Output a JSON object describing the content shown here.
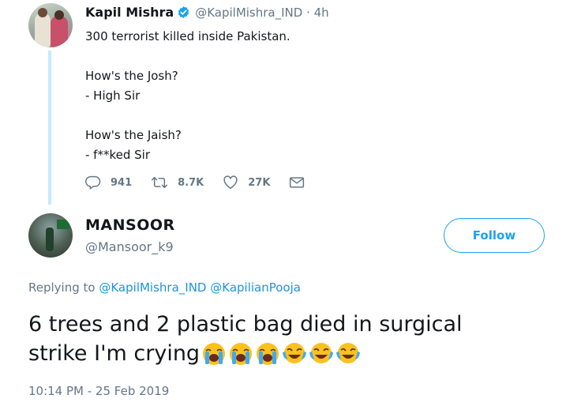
{
  "parent_tweet": {
    "author_name": "Kapil Mishra",
    "handle": "@KapilMishra_IND",
    "time_sep": " · ",
    "time": "4h",
    "lines": [
      "300 terrorist killed inside Pakistan.",
      "",
      "How's the Josh?",
      "- High Sir",
      "",
      "How's the Jaish?",
      "- f**ked Sir"
    ],
    "replies": "941",
    "retweets": "8.7K",
    "likes": "27K"
  },
  "main_tweet": {
    "author_name": "MANSOOR",
    "handle": "@Mansoor_k9",
    "follow_label": "Follow",
    "replying_prefix": "Replying to",
    "replying_to": [
      "@KapilMishra_IND",
      "@KapilianPooja"
    ],
    "text_line1": "6 trees and 2 plastic bag died in surgical",
    "text_line2": "strike I'm crying",
    "emojis": [
      "loudly-crying-face",
      "loudly-crying-face",
      "loudly-crying-face",
      "face-with-tears-of-joy",
      "face-with-tears-of-joy",
      "face-with-tears-of-joy"
    ],
    "timestamp": "10:14 PM - 25 Feb 2019"
  },
  "colors": {
    "accent": "#1da1f2",
    "link": "#1b95e0",
    "secondary_text": "#657786",
    "thread_line": "#c4eaf9"
  }
}
